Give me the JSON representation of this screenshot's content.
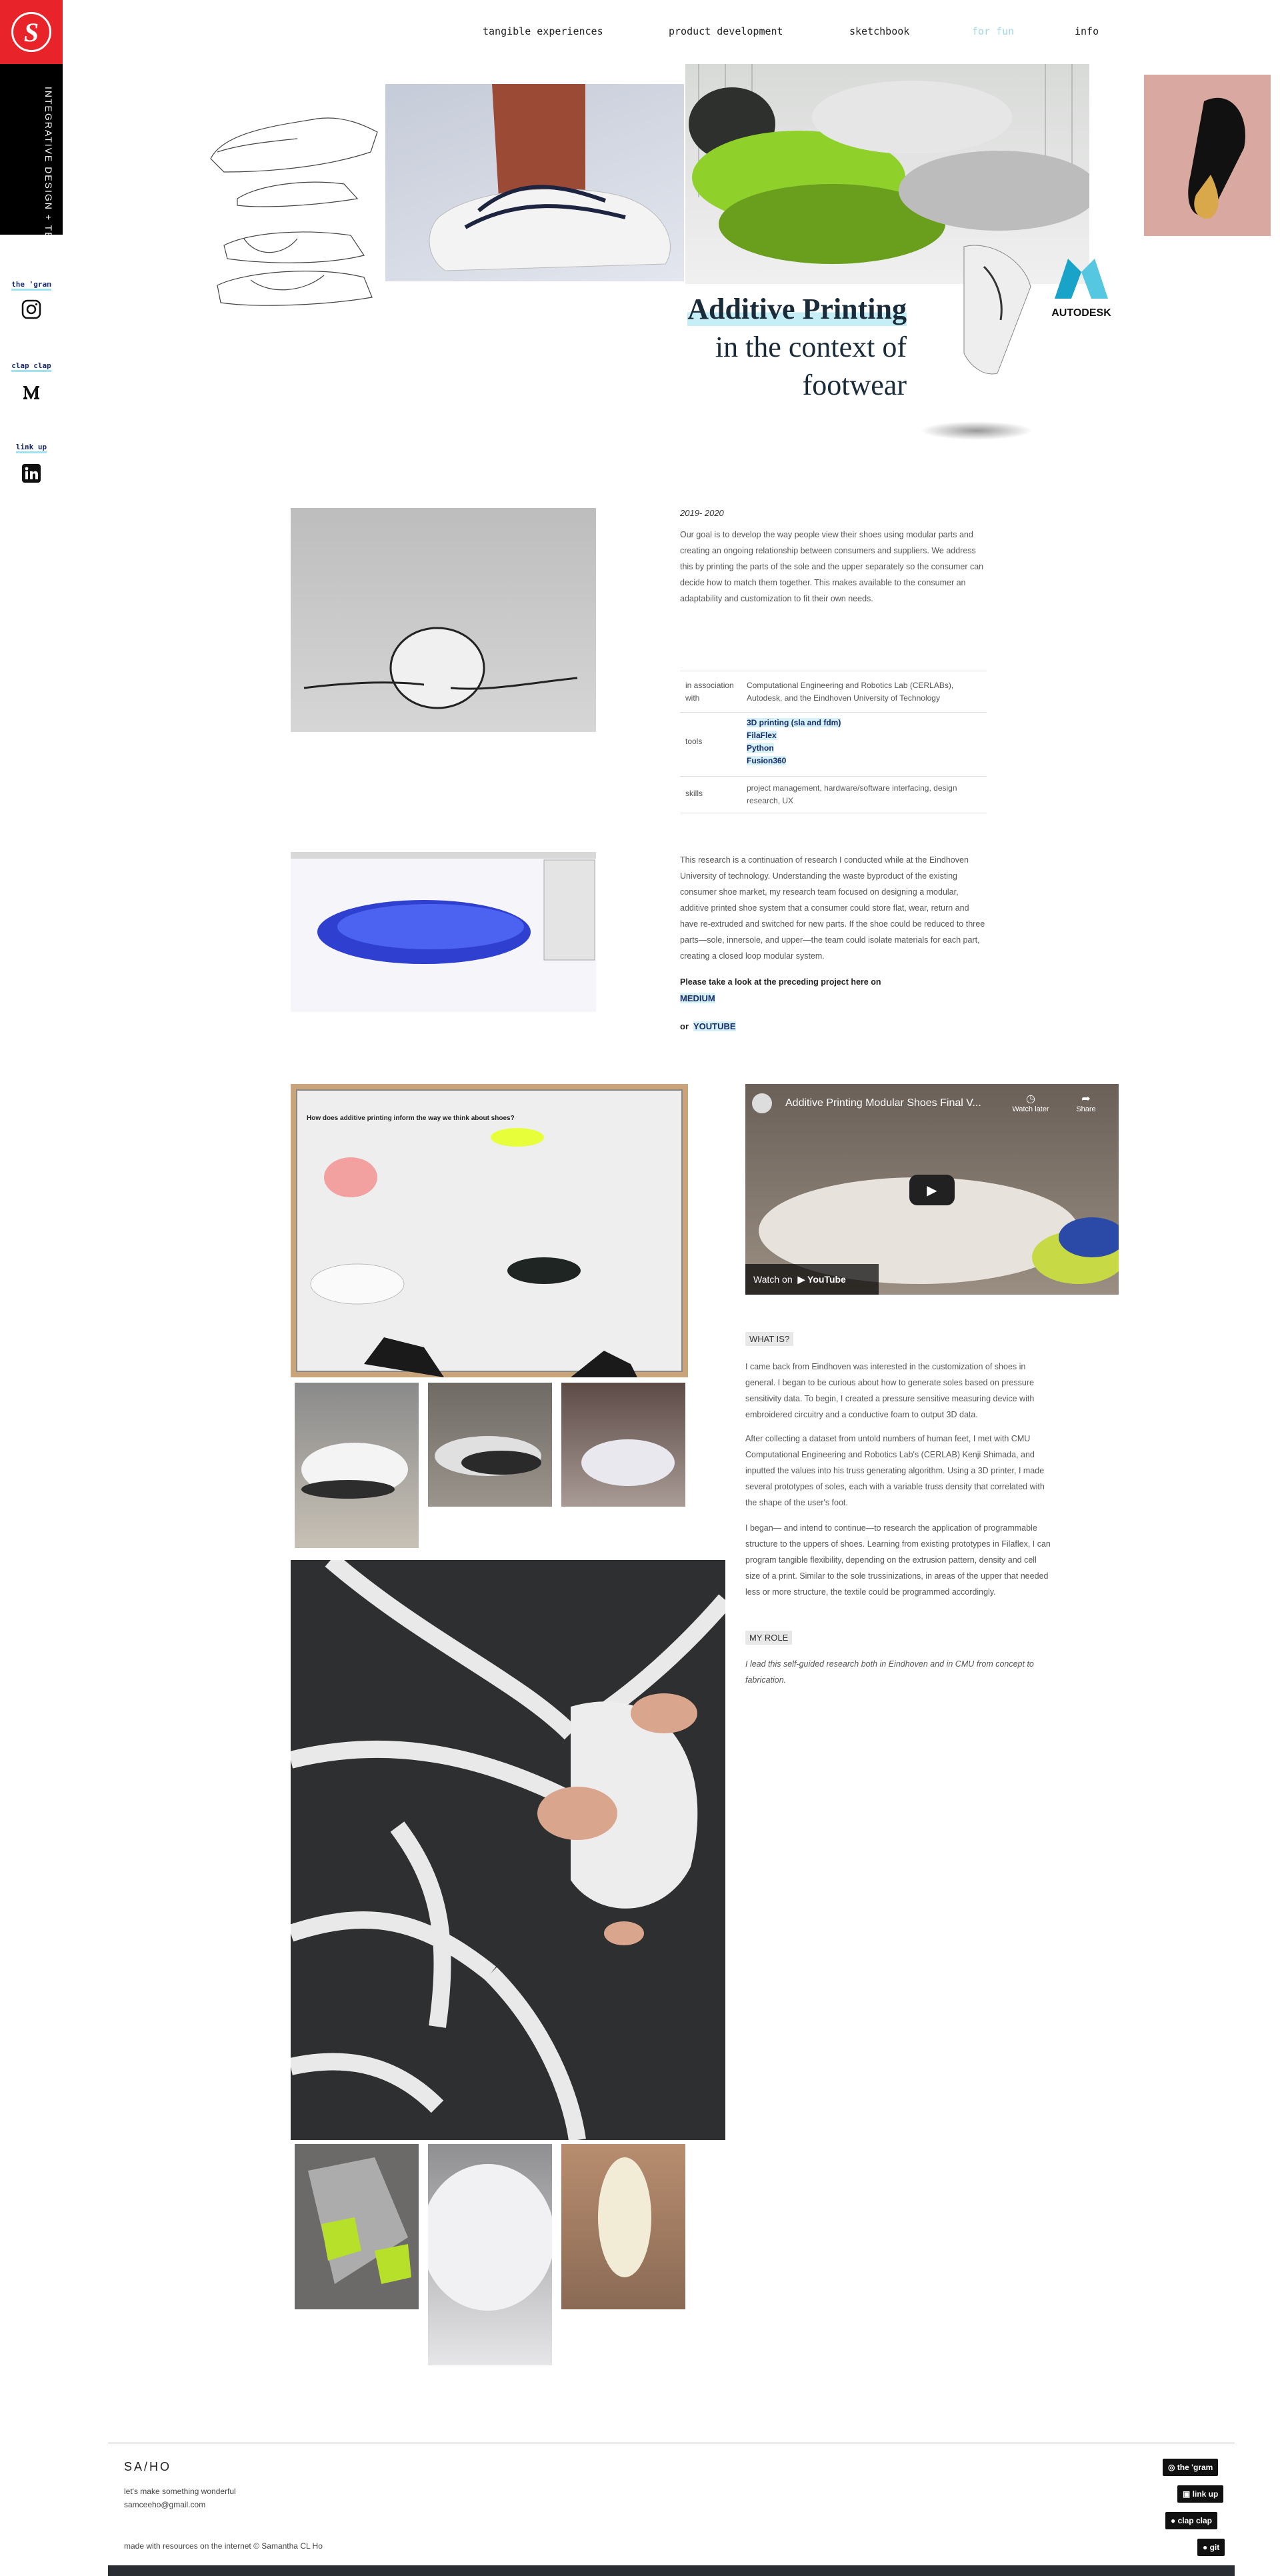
{
  "sidebar": {
    "logo_letter": "S",
    "vertical_text": "INTEGRATIVE DESIGN + TECHNOLOGY",
    "links": [
      {
        "label": "the 'gram",
        "icon": "instagram-icon"
      },
      {
        "label": "clap clap",
        "icon": "medium-icon"
      },
      {
        "label": "link up",
        "icon": "linkedin-icon"
      }
    ]
  },
  "nav": {
    "items": [
      "tangible experiences",
      "product development",
      "sketchbook",
      "for fun",
      "info"
    ],
    "active": "for fun"
  },
  "hero": {
    "title_main": "Additive Printing",
    "title_sub1": "in the context of",
    "title_sub2": "footwear",
    "autodesk": "AUTODESK"
  },
  "intro": {
    "date": "2019- 2020",
    "paragraph": "Our goal is to develop the way people view their shoes using modular parts and creating an ongoing relationship between consumers and suppliers. We address this by printing the parts of the sole and the upper separately so the consumer can decide how to match them together. This makes available to the consumer an adaptability and customization to fit their own needs."
  },
  "details": {
    "association_label": "in association with",
    "association_value": "Computational Engineering and Robotics Lab (CERLABs), Autodesk, and the Eindhoven University of Technology",
    "tools_label": "tools",
    "tools": [
      "3D printing (sla and fdm)",
      "FilaFlex",
      "Python",
      "Fusion360"
    ],
    "skills_label": "skills",
    "skills_value": "project management, hardware/software interfacing, design research, UX"
  },
  "research": {
    "paragraph": "This research is a continuation of research I conducted while at the Eindhoven University of technology. Understanding the waste byproduct of the existing consumer shoe market, my research team focused on designing a modular, additive printed shoe system that a consumer could store flat, wear, return and have re-extruded and switched for new parts. If the shoe could be reduced to three parts—sole, innersole, and upper—the team could isolate materials for each part, creating a closed loop modular system.",
    "preceding": "Please take a look at the preceding project here on",
    "medium": "MEDIUM",
    "or": "or",
    "youtube": "YOUTUBE"
  },
  "video": {
    "title": "Additive Printing Modular Shoes Final V...",
    "watch_later": "Watch later",
    "share": "Share",
    "watch_on": "Watch on",
    "youtube_brand": "YouTube"
  },
  "poster": {
    "heading": "How does additive printing inform the way we think about shoes?"
  },
  "what_is": {
    "heading": "WHAT IS?",
    "p1": "I came back from Eindhoven was interested in the customization of shoes in general. I began to be curious about how to generate soles based on pressure sensitivity data. To begin, I created a pressure sensitive measuring device with embroidered circuitry and a conductive foam to output 3D data.",
    "p2": "After collecting a dataset from untold numbers of human feet, I met with CMU Computational Engineering and Robotics Lab's (CERLAB) Kenji Shimada, and inputted the values into his truss generating algorithm. Using a 3D printer, I made several prototypes of soles, each with a variable truss density that correlated with the shape of the user's foot.",
    "p3": "I began— and intend to continue—to research the application of programmable structure to the uppers of shoes. Learning from existing prototypes in Filaflex, I can program tangible flexibility, depending on the extrusion pattern, density and cell size of a print. Similar to the sole trussinizations, in areas of the upper that needed less or more structure, the textile could be programmed accordingly."
  },
  "my_role": {
    "heading": "MY ROLE",
    "p": "I lead this self-guided research both in Eindhoven and in CMU from concept to fabrication."
  },
  "footer": {
    "brand": "SA/HO",
    "tagline": "let's make something wonderful",
    "email": "samceeho@gmail.com",
    "credit": "made with resources on the internet © Samantha CL Ho",
    "buttons": [
      "the 'gram",
      "link up",
      "clap clap",
      "git"
    ]
  },
  "colors": {
    "brand_red": "#e8242a",
    "accent_cyan": "#9fe3f0",
    "nav_active": "#9fd8e6",
    "link_navy": "#1a2b6b"
  }
}
